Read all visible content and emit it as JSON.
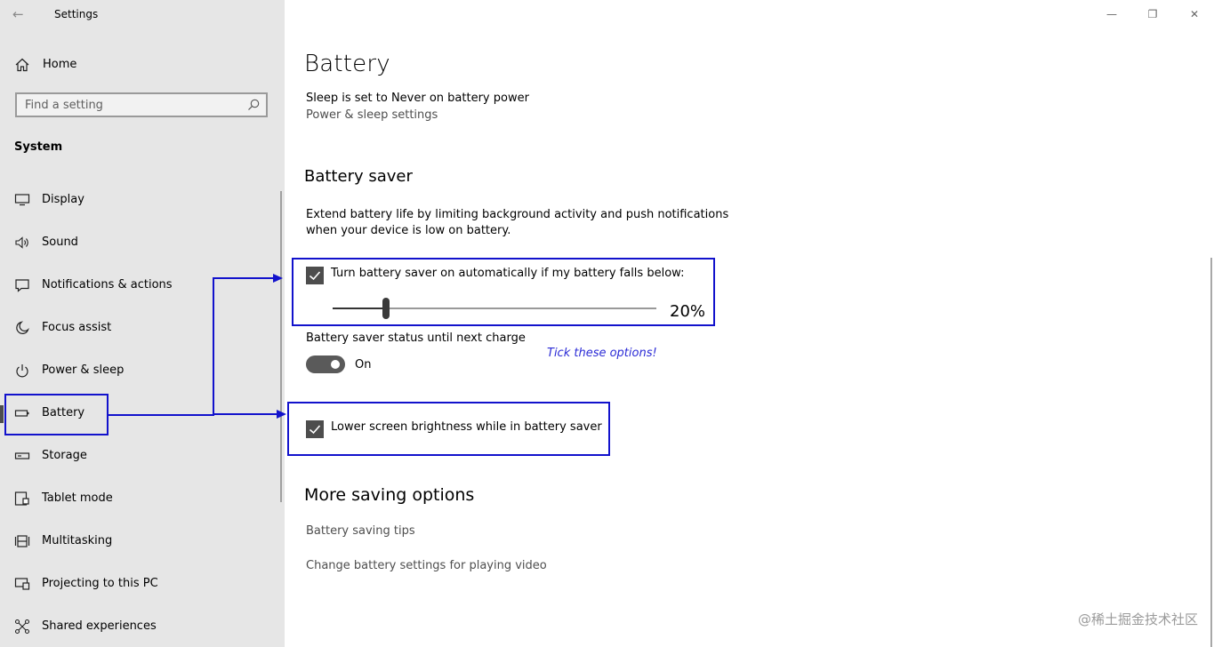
{
  "window": {
    "title": "Settings",
    "back_glyph": "←",
    "controls": {
      "minimize": "—",
      "maximize": "❐",
      "close": "✕"
    }
  },
  "sidebar": {
    "home": {
      "label": "Home",
      "icon": "home-icon"
    },
    "search": {
      "placeholder": "Find a setting",
      "icon": "search-icon"
    },
    "section": "System",
    "items": [
      {
        "label": "Display",
        "icon": "display-icon"
      },
      {
        "label": "Sound",
        "icon": "sound-icon"
      },
      {
        "label": "Notifications & actions",
        "icon": "notifications-icon"
      },
      {
        "label": "Focus assist",
        "icon": "moon-icon"
      },
      {
        "label": "Power & sleep",
        "icon": "power-icon"
      },
      {
        "label": "Battery",
        "icon": "battery-icon",
        "selected": true
      },
      {
        "label": "Storage",
        "icon": "storage-icon"
      },
      {
        "label": "Tablet mode",
        "icon": "tablet-icon"
      },
      {
        "label": "Multitasking",
        "icon": "multitasking-icon"
      },
      {
        "label": "Projecting to this PC",
        "icon": "projecting-icon"
      },
      {
        "label": "Shared experiences",
        "icon": "shared-icon"
      }
    ]
  },
  "main": {
    "title": "Battery",
    "sleep_text": "Sleep is set to Never on battery power",
    "power_link": "Power & sleep settings",
    "saver": {
      "heading": "Battery saver",
      "desc_line1": "Extend battery life by limiting background activity and push notifications",
      "desc_line2": "when your device is low on battery.",
      "auto_label": "Turn battery saver on automatically if my battery falls below:",
      "auto_checked": true,
      "threshold_percent": 20,
      "threshold_label": "20%",
      "status_label": "Battery saver status until next charge",
      "status_toggle": "On",
      "status_on": true,
      "brightness_label": "Lower screen brightness while in battery saver",
      "brightness_checked": true
    },
    "more": {
      "heading": "More saving options",
      "tips_link": "Battery saving tips",
      "video_link": "Change battery settings for playing video"
    }
  },
  "annotation": {
    "text": "Tick these options!",
    "color": "#1212cc"
  },
  "watermark": "@稀土掘金技术社区",
  "colors": {
    "sidebar_bg": "#e6e6e6",
    "accent_dark": "#4d4d4d",
    "annotation_blue": "#1212cc"
  }
}
